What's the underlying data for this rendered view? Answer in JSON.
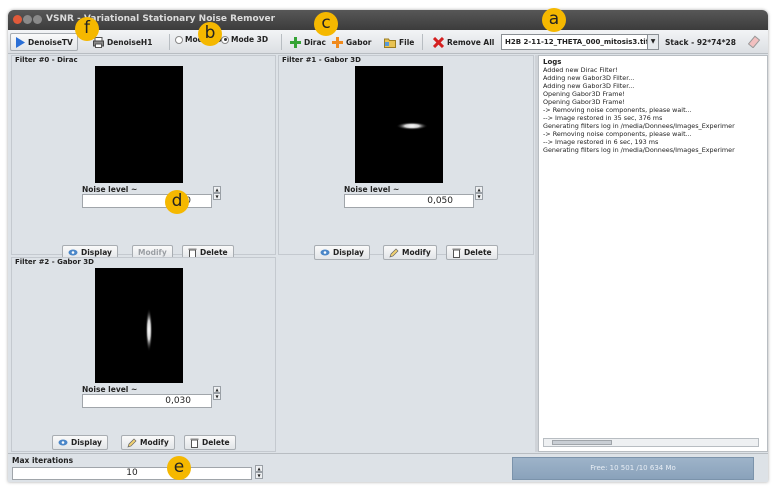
{
  "window": {
    "title": "VSNR - Variational Stationary Noise Remover"
  },
  "toolbar": {
    "denoise_tv": "DenoiseTV",
    "denoise_h1": "DenoiseH1",
    "mode_2d": "Mode 2D",
    "mode_3d": "Mode 3D",
    "mode_selected": "Mode 3D",
    "dirac": "Dirac",
    "gabor": "Gabor",
    "file": "File",
    "remove_all": "Remove All",
    "image_select": "H2B 2-11-12_THETA_000_mitosis3.tif",
    "stack": "Stack - 92*74*28"
  },
  "filters": [
    {
      "title": "Filter #0 - Dirac",
      "noise_label": "Noise level ~",
      "noise_value": "0,150",
      "display": "Display",
      "modify": "Modify",
      "delete": "Delete",
      "modify_enabled": false
    },
    {
      "title": "Filter #1 - Gabor 3D",
      "noise_label": "Noise level ~",
      "noise_value": "0,050",
      "display": "Display",
      "modify": "Modify",
      "delete": "Delete",
      "modify_enabled": true
    },
    {
      "title": "Filter #2 - Gabor 3D",
      "noise_label": "Noise level ~",
      "noise_value": "0,030",
      "display": "Display",
      "modify": "Modify",
      "delete": "Delete",
      "modify_enabled": true
    }
  ],
  "logs": {
    "title": "Logs",
    "lines": [
      "Added new Dirac Filter!",
      "Adding new Gabor3D Filter...",
      "Adding new Gabor3D Filter...",
      "Opening Gabor3D Frame!",
      "Opening Gabor3D Frame!",
      "-> Removing noise components, please wait...",
      "--> Image restored in 35 sec, 376 ms",
      "Generating filters log in /media/Donnees/Images_Experimer",
      "-> Removing noise components, please wait...",
      "--> Image restored in 6 sec, 193 ms",
      "Generating filters log in /media/Donnees/Images_Experimer"
    ]
  },
  "bottom": {
    "max_iterations_label": "Max iterations",
    "max_iterations_value": "10",
    "memory": "Free: 10 501 /10 634 Mo"
  },
  "annotations": [
    "a",
    "b",
    "c",
    "d",
    "e",
    "f"
  ],
  "colors": {
    "annotation_badge": "#f5b800",
    "memory_bar": "#9db3c9",
    "toolbar_play": "#2a6fd6"
  }
}
